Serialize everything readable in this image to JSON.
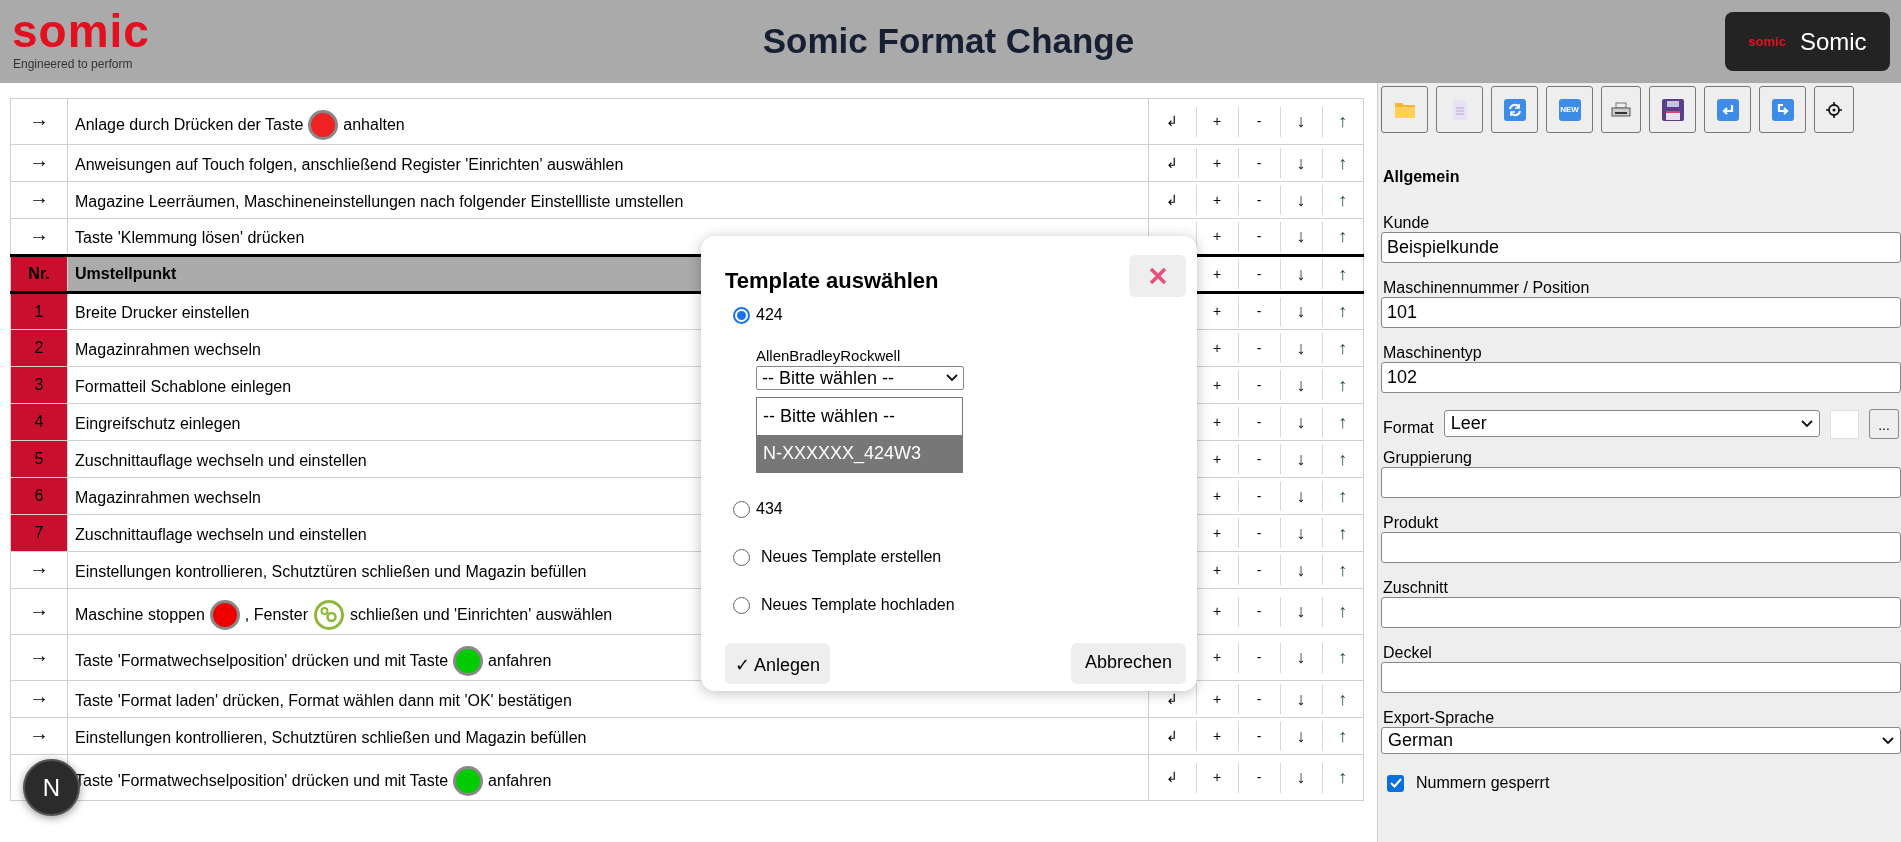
{
  "header": {
    "logo_text": "somic",
    "logo_tagline": "Engineered to perform",
    "title": "Somic Format Change",
    "account_button": {
      "logo_text": "somic",
      "label": "Somic"
    }
  },
  "steps": [
    {
      "kind": "instruction",
      "marker": "→",
      "parts": [
        {
          "kind": "text",
          "text": "Anlage durch Drücken der Taste"
        },
        {
          "kind": "button",
          "color": "#ee2222"
        },
        {
          "kind": "text",
          "text": "anhalten"
        }
      ],
      "actions": [
        {
          "kind": "insert",
          "label": "↲"
        },
        {
          "kind": "add",
          "label": "+"
        },
        {
          "kind": "remove",
          "label": "-"
        },
        {
          "kind": "down",
          "label": "↓"
        },
        {
          "kind": "up",
          "label": "↑"
        }
      ]
    },
    {
      "kind": "instruction",
      "marker": "→",
      "parts": [
        {
          "kind": "text",
          "text": "Anweisungen auf Touch folgen, anschließend Register 'Einrichten' auswählen"
        }
      ],
      "actions": [
        {
          "kind": "insert",
          "label": "↲"
        },
        {
          "kind": "add",
          "label": "+"
        },
        {
          "kind": "remove",
          "label": "-"
        },
        {
          "kind": "down",
          "label": "↓"
        },
        {
          "kind": "up",
          "label": "↑"
        }
      ]
    },
    {
      "kind": "instruction",
      "marker": "→",
      "parts": [
        {
          "kind": "text",
          "text": "Magazine Leerräumen, Maschineneinstellungen nach folgender Einstellliste umstellen"
        }
      ],
      "actions": [
        {
          "kind": "insert",
          "label": "↲"
        },
        {
          "kind": "add",
          "label": "+"
        },
        {
          "kind": "remove",
          "label": "-"
        },
        {
          "kind": "down",
          "label": "↓"
        },
        {
          "kind": "up",
          "label": "↑"
        }
      ]
    },
    {
      "kind": "instruction",
      "marker": "→",
      "parts": [
        {
          "kind": "text",
          "text": "Taste 'Klemmung lösen' drücken"
        }
      ],
      "actions": [
        {
          "kind": "add",
          "label": "+"
        },
        {
          "kind": "remove",
          "label": "-"
        },
        {
          "kind": "down",
          "label": "↓"
        },
        {
          "kind": "up",
          "label": "↑"
        }
      ]
    },
    {
      "kind": "header",
      "number": "Nr.",
      "parts": [
        {
          "kind": "text",
          "text": "Umstellpunkt"
        }
      ],
      "actions": [
        {
          "kind": "add",
          "label": "+"
        },
        {
          "kind": "remove",
          "label": "-"
        },
        {
          "kind": "down",
          "label": "↓"
        },
        {
          "kind": "up",
          "label": "↑"
        }
      ]
    },
    {
      "kind": "numbered",
      "number": "1",
      "parts": [
        {
          "kind": "text",
          "text": "Breite Drucker einstellen"
        }
      ],
      "actions": [
        {
          "kind": "add",
          "label": "+"
        },
        {
          "kind": "remove",
          "label": "-"
        },
        {
          "kind": "down",
          "label": "↓"
        },
        {
          "kind": "up",
          "label": "↑"
        }
      ]
    },
    {
      "kind": "numbered",
      "number": "2",
      "parts": [
        {
          "kind": "text",
          "text": "Magazinrahmen wechseln"
        }
      ],
      "actions": [
        {
          "kind": "add",
          "label": "+"
        },
        {
          "kind": "remove",
          "label": "-"
        },
        {
          "kind": "down",
          "label": "↓"
        },
        {
          "kind": "up",
          "label": "↑"
        }
      ]
    },
    {
      "kind": "numbered",
      "number": "3",
      "parts": [
        {
          "kind": "text",
          "text": "Formatteil Schablone einlegen"
        }
      ],
      "actions": [
        {
          "kind": "add",
          "label": "+"
        },
        {
          "kind": "remove",
          "label": "-"
        },
        {
          "kind": "down",
          "label": "↓"
        },
        {
          "kind": "up",
          "label": "↑"
        }
      ]
    },
    {
      "kind": "numbered",
      "number": "4",
      "parts": [
        {
          "kind": "text",
          "text": "Eingreifschutz einlegen"
        }
      ],
      "actions": [
        {
          "kind": "add",
          "label": "+"
        },
        {
          "kind": "remove",
          "label": "-"
        },
        {
          "kind": "down",
          "label": "↓"
        },
        {
          "kind": "up",
          "label": "↑"
        }
      ]
    },
    {
      "kind": "numbered",
      "number": "5",
      "parts": [
        {
          "kind": "text",
          "text": "Zuschnittauflage wechseln und einstellen"
        }
      ],
      "actions": [
        {
          "kind": "add",
          "label": "+"
        },
        {
          "kind": "remove",
          "label": "-"
        },
        {
          "kind": "down",
          "label": "↓"
        },
        {
          "kind": "up",
          "label": "↑"
        }
      ]
    },
    {
      "kind": "numbered",
      "number": "6",
      "parts": [
        {
          "kind": "text",
          "text": "Magazinrahmen wechseln"
        }
      ],
      "actions": [
        {
          "kind": "add",
          "label": "+"
        },
        {
          "kind": "remove",
          "label": "-"
        },
        {
          "kind": "down",
          "label": "↓"
        },
        {
          "kind": "up",
          "label": "↑"
        }
      ]
    },
    {
      "kind": "numbered",
      "number": "7",
      "parts": [
        {
          "kind": "text",
          "text": "Zuschnittauflage wechseln und einstellen"
        }
      ],
      "actions": [
        {
          "kind": "add",
          "label": "+"
        },
        {
          "kind": "remove",
          "label": "-"
        },
        {
          "kind": "down",
          "label": "↓"
        },
        {
          "kind": "up",
          "label": "↑"
        }
      ]
    },
    {
      "kind": "instruction",
      "marker": "→",
      "parts": [
        {
          "kind": "text",
          "text": "Einstellungen kontrollieren, Schutztüren schließen und Magazin befüllen"
        }
      ],
      "actions": [
        {
          "kind": "add",
          "label": "+"
        },
        {
          "kind": "remove",
          "label": "-"
        },
        {
          "kind": "down",
          "label": "↓"
        },
        {
          "kind": "up",
          "label": "↑"
        }
      ]
    },
    {
      "kind": "instruction",
      "marker": "→",
      "parts": [
        {
          "kind": "text",
          "text": "Maschine stoppen"
        },
        {
          "kind": "button",
          "color": "#ee0000"
        },
        {
          "kind": "text",
          "text": ", Fenster"
        },
        {
          "kind": "window-icon"
        },
        {
          "kind": "text",
          "text": "schließen und 'Einrichten' auswählen"
        }
      ],
      "actions": [
        {
          "kind": "add",
          "label": "+"
        },
        {
          "kind": "remove",
          "label": "-"
        },
        {
          "kind": "down",
          "label": "↓"
        },
        {
          "kind": "up",
          "label": "↑"
        }
      ]
    },
    {
      "kind": "instruction",
      "marker": "→",
      "parts": [
        {
          "kind": "text",
          "text": "Taste 'Formatwechselposition' drücken und mit Taste"
        },
        {
          "kind": "button",
          "color": "#00cc00"
        },
        {
          "kind": "text",
          "text": "anfahren"
        }
      ],
      "actions": [
        {
          "kind": "add",
          "label": "+"
        },
        {
          "kind": "remove",
          "label": "-"
        },
        {
          "kind": "down",
          "label": "↓"
        },
        {
          "kind": "up",
          "label": "↑"
        }
      ]
    },
    {
      "kind": "instruction",
      "marker": "→",
      "parts": [
        {
          "kind": "text",
          "text": "Taste 'Format laden' drücken, Format wählen dann mit 'OK' bestätigen"
        }
      ],
      "actions": [
        {
          "kind": "insert",
          "label": "↲"
        },
        {
          "kind": "add",
          "label": "+"
        },
        {
          "kind": "remove",
          "label": "-"
        },
        {
          "kind": "down",
          "label": "↓"
        },
        {
          "kind": "up",
          "label": "↑"
        }
      ]
    },
    {
      "kind": "instruction",
      "marker": "→",
      "parts": [
        {
          "kind": "text",
          "text": "Einstellungen kontrollieren, Schutztüren schließen und Magazin befüllen"
        }
      ],
      "actions": [
        {
          "kind": "insert",
          "label": "↲"
        },
        {
          "kind": "add",
          "label": "+"
        },
        {
          "kind": "remove",
          "label": "-"
        },
        {
          "kind": "down",
          "label": "↓"
        },
        {
          "kind": "up",
          "label": "↑"
        }
      ]
    },
    {
      "kind": "instruction",
      "parts": [
        {
          "kind": "text",
          "text": "Taste 'Formatwechselposition' drücken und mit Taste"
        },
        {
          "kind": "button",
          "color": "#00cc00"
        },
        {
          "kind": "text",
          "text": "anfahren"
        }
      ],
      "actions": [
        {
          "kind": "insert",
          "label": "↲"
        },
        {
          "kind": "add",
          "label": "+"
        },
        {
          "kind": "remove",
          "label": "-"
        },
        {
          "kind": "down",
          "label": "↓"
        },
        {
          "kind": "up",
          "label": "↑"
        }
      ]
    }
  ],
  "toolbar": [
    {
      "kind": "open"
    },
    {
      "kind": "document"
    },
    {
      "kind": "refresh"
    },
    {
      "kind": "new",
      "label": "NEW"
    },
    {
      "kind": "print"
    },
    {
      "kind": "save"
    },
    {
      "kind": "undo"
    },
    {
      "kind": "redo"
    },
    {
      "kind": "settings"
    }
  ],
  "form": {
    "section_title": "Allgemein",
    "fields": [
      {
        "kind": "text",
        "label": "Kunde",
        "value": "Beispielkunde"
      },
      {
        "kind": "text",
        "label": "Maschinennummer / Position",
        "value": "101"
      },
      {
        "kind": "text",
        "label": "Maschinentyp",
        "value": "102"
      },
      {
        "kind": "format",
        "label": "Format",
        "value": "Leer",
        "more": "..."
      },
      {
        "kind": "text",
        "label": "Gruppierung"
      },
      {
        "kind": "text",
        "label": "Produkt"
      },
      {
        "kind": "text",
        "label": "Zuschnitt"
      },
      {
        "kind": "text",
        "label": "Deckel"
      },
      {
        "kind": "select",
        "label": "Export-Sprache",
        "value": "German"
      }
    ],
    "checkbox": {
      "label": "Nummern gesperrt",
      "checked": true
    }
  },
  "modal": {
    "title": "Template auswählen",
    "options": [
      {
        "label": "424",
        "selected": true,
        "plc_label": "AllenBradleyRockwell",
        "select_value": "-- Bitte wählen --",
        "dropdown": [
          {
            "label": "-- Bitte wählen --",
            "selected": false
          },
          {
            "label": "N-XXXXXX_424W3",
            "selected": true
          }
        ]
      },
      {
        "label": "434",
        "selected": false
      },
      {
        "label": "Neues Template erstellen",
        "selected": false
      },
      {
        "label": "Neues Template hochladen",
        "selected": false
      }
    ],
    "buttons": [
      {
        "kind": "confirm",
        "label": "✓ Anlegen"
      },
      {
        "kind": "cancel",
        "label": "Abbrechen"
      }
    ]
  },
  "dev_badge": "N"
}
